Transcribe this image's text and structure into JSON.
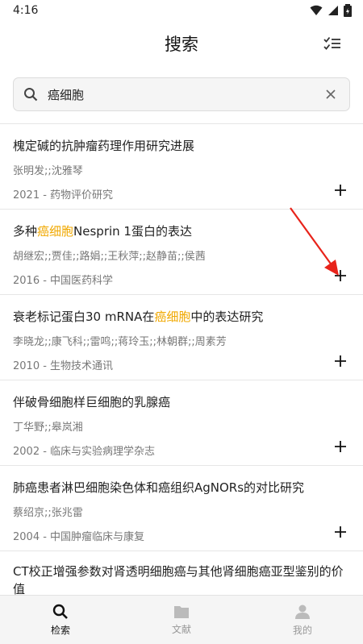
{
  "status": {
    "time": "4:16"
  },
  "header": {
    "title": "搜索",
    "action_icon": "checklist-icon"
  },
  "search": {
    "value": "癌细胞",
    "clear_icon": "close-icon"
  },
  "highlight_color": "#f0a800",
  "results": [
    {
      "title": "槐定碱的抗肿瘤药理作用研究进展",
      "title_parts": [
        "槐定碱的抗肿瘤药理作用研究进展"
      ],
      "authors": "张明发;;沈雅琴",
      "meta": "2021 - 药物评价研究"
    },
    {
      "title_parts": [
        "多种",
        "癌细胞",
        "Nesprin 1蛋白的表达"
      ],
      "authors": "胡继宏;;贾佳;;路娟;;王秋萍;;赵静苗;;侯茜",
      "meta": "2016 - 中国医药科学"
    },
    {
      "title_parts": [
        "衰老标记蛋白30 mRNA在",
        "癌细胞",
        "中的表达研究"
      ],
      "authors": "李晓龙;;康飞科;;雷鸣;;蒋玲玉;;林朝群;;周素芳",
      "meta": "2010 - 生物技术通讯"
    },
    {
      "title_parts": [
        "伴破骨细胞样巨细胞的乳腺癌"
      ],
      "authors": "丁华野;;皋岚湘",
      "meta": "2002 - 临床与实验病理学杂志"
    },
    {
      "title_parts": [
        "肺癌患者淋巴细胞染色体和癌组织AgNORs的对比研究"
      ],
      "authors": "蔡绍京;;张兆雷",
      "meta": "2004 - 中国肿瘤临床与康复"
    },
    {
      "title_parts": [
        "CT校正增强参数对肾透明细胞癌与其他肾细胞癌亚型鉴别的价值"
      ]
    }
  ],
  "bottom_nav": [
    {
      "label": "检索",
      "icon": "search-icon",
      "active": true
    },
    {
      "label": "文献",
      "icon": "folder-icon",
      "active": false
    },
    {
      "label": "我的",
      "icon": "person-icon",
      "active": false
    }
  ]
}
